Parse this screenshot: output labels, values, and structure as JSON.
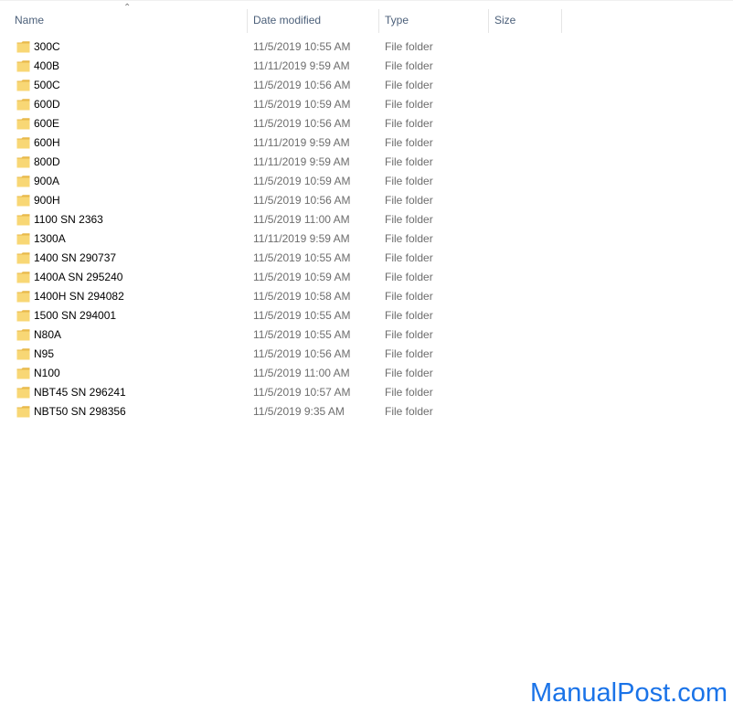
{
  "columns": {
    "name": "Name",
    "date_modified": "Date modified",
    "type": "Type",
    "size": "Size"
  },
  "sort": {
    "column": "name",
    "direction": "ascending"
  },
  "colors": {
    "folder_fill": "#f8d775",
    "folder_tab": "#e8b94a",
    "header_text": "#4c607a",
    "meta_text": "#6d6d6d",
    "watermark": "#1a73e8"
  },
  "files": [
    {
      "name": "300C",
      "date": "11/5/2019 10:55 AM",
      "type": "File folder",
      "size": ""
    },
    {
      "name": "400B",
      "date": "11/11/2019 9:59 AM",
      "type": "File folder",
      "size": ""
    },
    {
      "name": "500C",
      "date": "11/5/2019 10:56 AM",
      "type": "File folder",
      "size": ""
    },
    {
      "name": "600D",
      "date": "11/5/2019 10:59 AM",
      "type": "File folder",
      "size": ""
    },
    {
      "name": "600E",
      "date": "11/5/2019 10:56 AM",
      "type": "File folder",
      "size": ""
    },
    {
      "name": "600H",
      "date": "11/11/2019 9:59 AM",
      "type": "File folder",
      "size": ""
    },
    {
      "name": "800D",
      "date": "11/11/2019 9:59 AM",
      "type": "File folder",
      "size": ""
    },
    {
      "name": "900A",
      "date": "11/5/2019 10:59 AM",
      "type": "File folder",
      "size": ""
    },
    {
      "name": "900H",
      "date": "11/5/2019 10:56 AM",
      "type": "File folder",
      "size": ""
    },
    {
      "name": "1100 SN 2363",
      "date": "11/5/2019 11:00 AM",
      "type": "File folder",
      "size": ""
    },
    {
      "name": "1300A",
      "date": "11/11/2019 9:59 AM",
      "type": "File folder",
      "size": ""
    },
    {
      "name": "1400 SN 290737",
      "date": "11/5/2019 10:55 AM",
      "type": "File folder",
      "size": ""
    },
    {
      "name": "1400A SN 295240",
      "date": "11/5/2019 10:59 AM",
      "type": "File folder",
      "size": ""
    },
    {
      "name": "1400H SN 294082",
      "date": "11/5/2019 10:58 AM",
      "type": "File folder",
      "size": ""
    },
    {
      "name": "1500 SN 294001",
      "date": "11/5/2019 10:55 AM",
      "type": "File folder",
      "size": ""
    },
    {
      "name": "N80A",
      "date": "11/5/2019 10:55 AM",
      "type": "File folder",
      "size": ""
    },
    {
      "name": "N95",
      "date": "11/5/2019 10:56 AM",
      "type": "File folder",
      "size": ""
    },
    {
      "name": "N100",
      "date": "11/5/2019 11:00 AM",
      "type": "File folder",
      "size": ""
    },
    {
      "name": "NBT45 SN 296241",
      "date": "11/5/2019 10:57 AM",
      "type": "File folder",
      "size": ""
    },
    {
      "name": "NBT50 SN 298356",
      "date": "11/5/2019 9:35 AM",
      "type": "File folder",
      "size": ""
    }
  ],
  "watermark": "ManualPost.com"
}
